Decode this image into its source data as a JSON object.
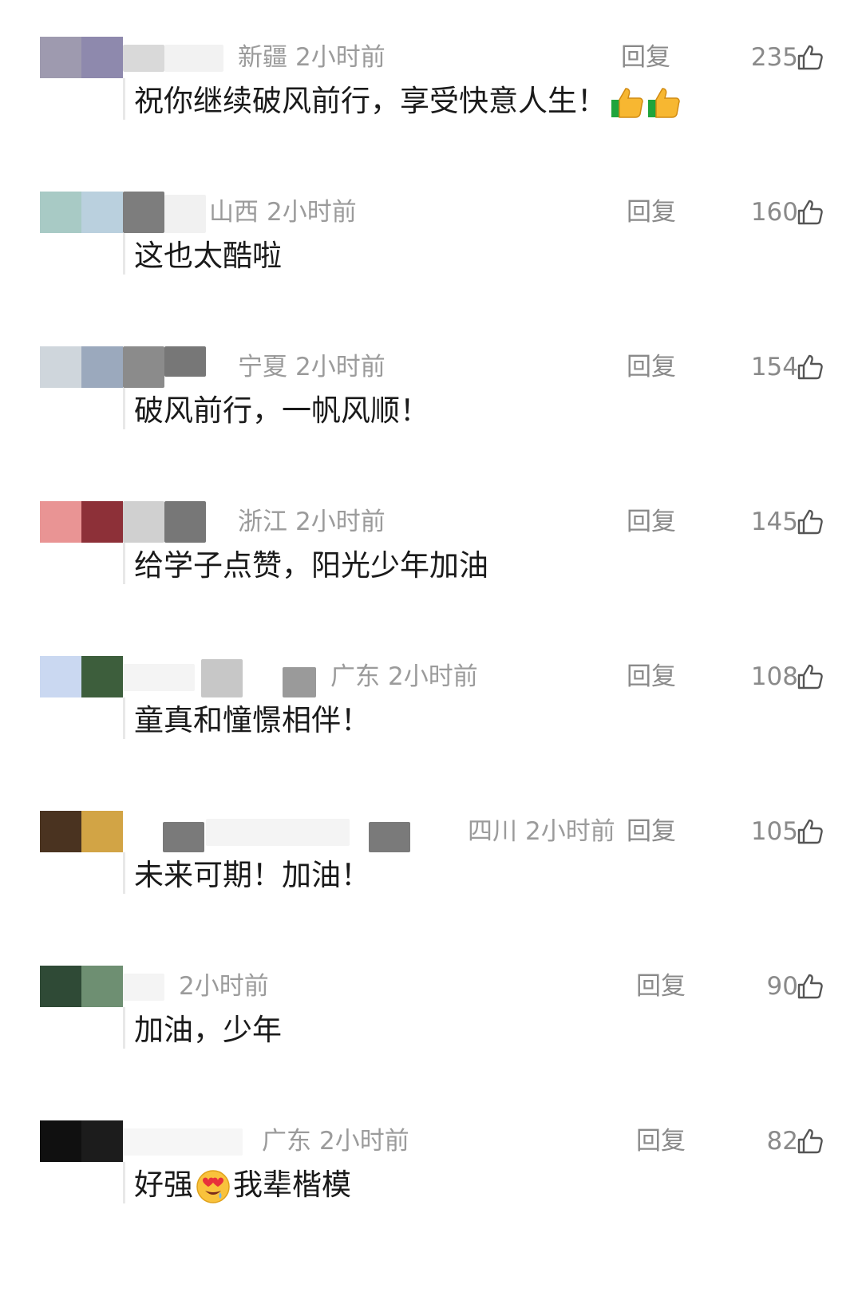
{
  "labels": {
    "reply": "回复"
  },
  "comments": [
    {
      "location": "新疆",
      "time": "2小时前",
      "likes": "235",
      "text": "祝你继续破风前行，享受快意人生！",
      "emoji": "thumbs-up ×2",
      "avatar_colors": [
        "#9e9aaf",
        "#8e89ad",
        "#d9d9d9",
        "#eeeeee"
      ]
    },
    {
      "location": "山西",
      "time": "2小时前",
      "likes": "160",
      "text": "这也太酷啦",
      "avatar_colors": [
        "#a8cac5",
        "#bad0de",
        "#7d7d7d",
        "#f1f1f1"
      ]
    },
    {
      "location": "宁夏",
      "time": "2小时前",
      "likes": "154",
      "text": "破风前行，一帆风顺！",
      "avatar_colors": [
        "#cfd6dc",
        "#9ba9bd",
        "#8b8b8b",
        "#777777"
      ]
    },
    {
      "location": "浙江",
      "time": "2小时前",
      "likes": "145",
      "text": "给学子点赞，阳光少年加油",
      "avatar_colors": [
        "#e99494",
        "#8d3038",
        "#d0d0d0",
        "#777777"
      ]
    },
    {
      "location": "广东",
      "time": "2小时前",
      "likes": "108",
      "text": "童真和憧憬相伴！",
      "avatar_colors": [
        "#cad8f1",
        "#3d5e3c",
        "#f4f4f4",
        "#c7c7c7"
      ]
    },
    {
      "location": "四川",
      "time": "2小时前",
      "likes": "105",
      "text": "未来可期！加油！",
      "avatar_colors": [
        "#4a3320",
        "#d2a445",
        "#f2f2f2",
        "#7a7a7a"
      ]
    },
    {
      "location": "",
      "time": "2小时前",
      "likes": "90",
      "text": "加油，少年",
      "avatar_colors": [
        "#2f4a36",
        "#6e8f72",
        "#f4f4f4",
        "#f4f4f4"
      ]
    },
    {
      "location": "广东",
      "time": "2小时前",
      "likes": "82",
      "text_before": "好强",
      "emoji": "heart-eyes",
      "text_after": "我辈楷模",
      "avatar_colors": [
        "#101010",
        "#1c1c1c",
        "#f4f4f4",
        "#f4f4f4"
      ]
    }
  ]
}
